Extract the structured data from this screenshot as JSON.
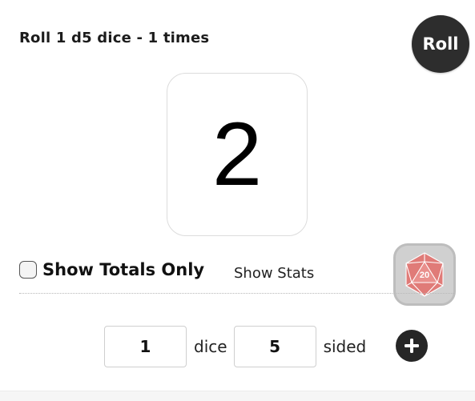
{
  "header": {
    "title": "Roll 1 d5 dice - 1 times",
    "roll_label": "Roll"
  },
  "result": {
    "value": "2"
  },
  "options": {
    "show_totals_label": "Show Totals Only",
    "show_totals_checked": false,
    "show_stats_label": "Show Stats",
    "d20_icon_number": "20"
  },
  "config": {
    "dice_count": "1",
    "dice_label": "dice",
    "sides": "5",
    "sided_label": "sided"
  },
  "icons": {
    "d20": "d20-icon",
    "add": "plus-icon"
  },
  "colors": {
    "roll_button": "#2d2d2d",
    "d20_fill": "#e07b78",
    "d20_frame": "#d0d0d0",
    "add_button": "#262626"
  }
}
